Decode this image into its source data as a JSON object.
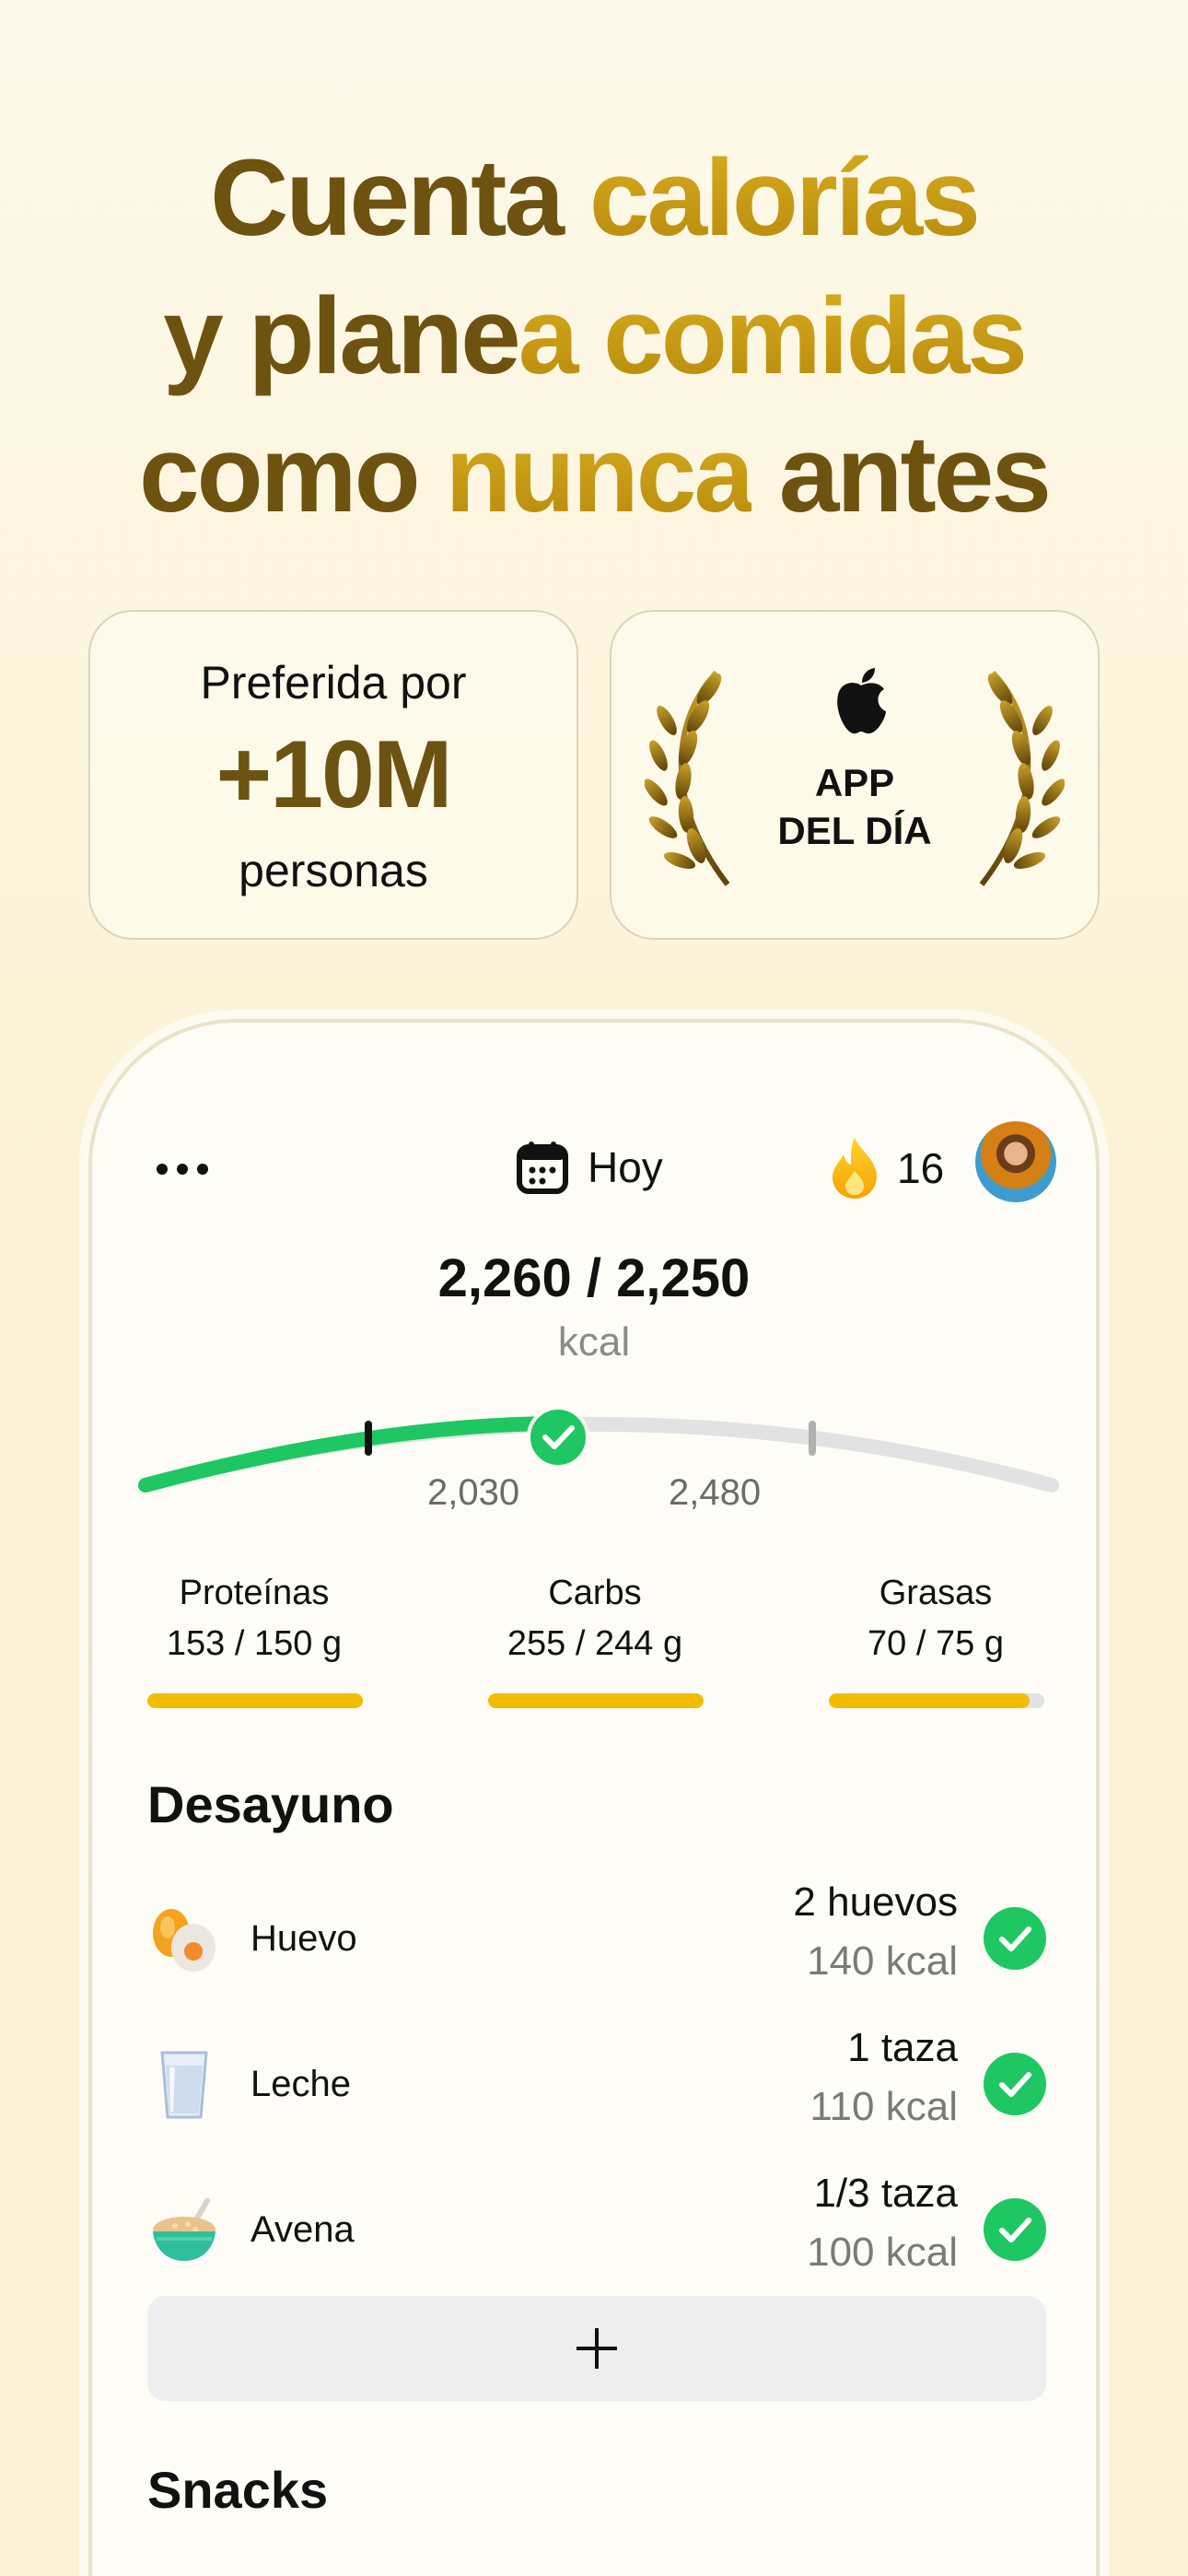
{
  "headline": {
    "line1": [
      {
        "t": "Cuenta ",
        "s": "dark"
      },
      {
        "t": "calorías",
        "s": "gold"
      }
    ],
    "line2": [
      {
        "t": "y plane",
        "s": "dark"
      },
      {
        "t": "a comidas",
        "s": "gold"
      }
    ],
    "line3": [
      {
        "t": "como ",
        "s": "dark"
      },
      {
        "t": "nunca",
        "s": "gold"
      },
      {
        "t": " antes",
        "s": "dark"
      }
    ]
  },
  "badge_users": {
    "top": "Preferida por",
    "big": "+10M",
    "bottom": "personas"
  },
  "badge_award": {
    "line1": "APP",
    "line2": "DEL DÍA"
  },
  "app": {
    "date_label": "Hoy",
    "streak_count": "16",
    "calories": {
      "summary": "2,260 / 2,250",
      "unit": "kcal",
      "low_marker": "2,030",
      "high_marker": "2,480"
    },
    "macros": [
      {
        "name": "Proteínas",
        "value": "153 / 150 g",
        "progress": 1.0
      },
      {
        "name": "Carbs",
        "value": "255 / 244 g",
        "progress": 1.0
      },
      {
        "name": "Grasas",
        "value": "70 / 75 g",
        "progress": 0.93
      }
    ],
    "breakfast": {
      "title": "Desayuno",
      "items": [
        {
          "name": "Huevo",
          "qty": "2 huevos",
          "kcal": "140 kcal",
          "icon": "egg-icon"
        },
        {
          "name": "Leche",
          "qty": "1 taza",
          "kcal": "110 kcal",
          "icon": "milk-glass-icon"
        },
        {
          "name": "Avena",
          "qty": "1/3 taza",
          "kcal": "100 kcal",
          "icon": "oat-bowl-icon"
        }
      ]
    },
    "snacks_title": "Snacks"
  },
  "colors": {
    "gold": "#c49a12",
    "dark_gold": "#6f5510",
    "accent_green": "#1fc762",
    "macro_yellow": "#f2bd00"
  }
}
